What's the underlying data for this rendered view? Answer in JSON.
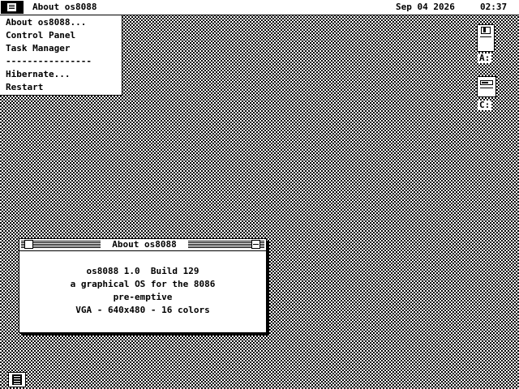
{
  "menubar": {
    "logo_icon": "chip-icon",
    "active_title": "About os8088",
    "date": "Sep 04 2026",
    "time": "02:37"
  },
  "dropdown": {
    "items": [
      "About os8088...",
      "Control Panel",
      "Task Manager",
      "----------------",
      "Hibernate...",
      "Restart"
    ]
  },
  "desktop": {
    "drives": [
      {
        "label": "A:",
        "icon": "floppy-drive-icon"
      },
      {
        "label": "C:",
        "icon": "hard-drive-icon"
      }
    ]
  },
  "dialog": {
    "title": "About os8088",
    "lines": [
      "os8088 1.0  Build 129",
      "a graphical OS for the 8086",
      "pre-emptive",
      "VGA - 640x480 - 16 colors"
    ]
  },
  "taskbar": {
    "task_icon": "chip-icon"
  }
}
